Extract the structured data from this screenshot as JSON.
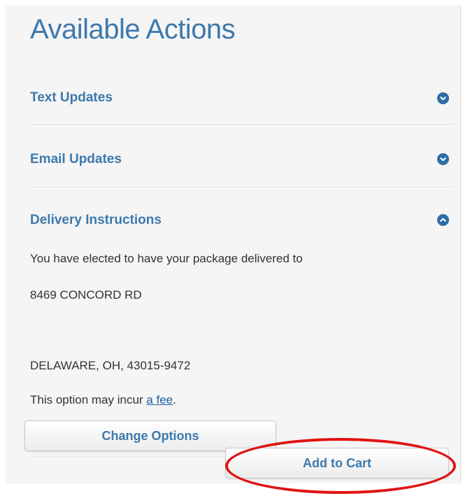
{
  "title": "Available Actions",
  "sections": {
    "text_updates": {
      "label": "Text Updates",
      "icon": "chevron-down-icon"
    },
    "email_updates": {
      "label": "Email Updates",
      "icon": "chevron-down-icon"
    },
    "delivery_instructions": {
      "label": "Delivery Instructions",
      "icon": "chevron-up-icon",
      "line1": "You have elected to have your package delivered to",
      "address1": "8469 CONCORD RD",
      "address2": "DELAWARE, OH, 43015-9472",
      "fee_prefix": "This option may incur ",
      "fee_link": "a fee",
      "fee_suffix": "."
    }
  },
  "buttons": {
    "change_options": "Change Options",
    "add_to_cart": "Add to Cart"
  },
  "colors": {
    "accent": "#3d79ad",
    "toggle": "#2e6ea6",
    "highlight": "#e01313"
  }
}
